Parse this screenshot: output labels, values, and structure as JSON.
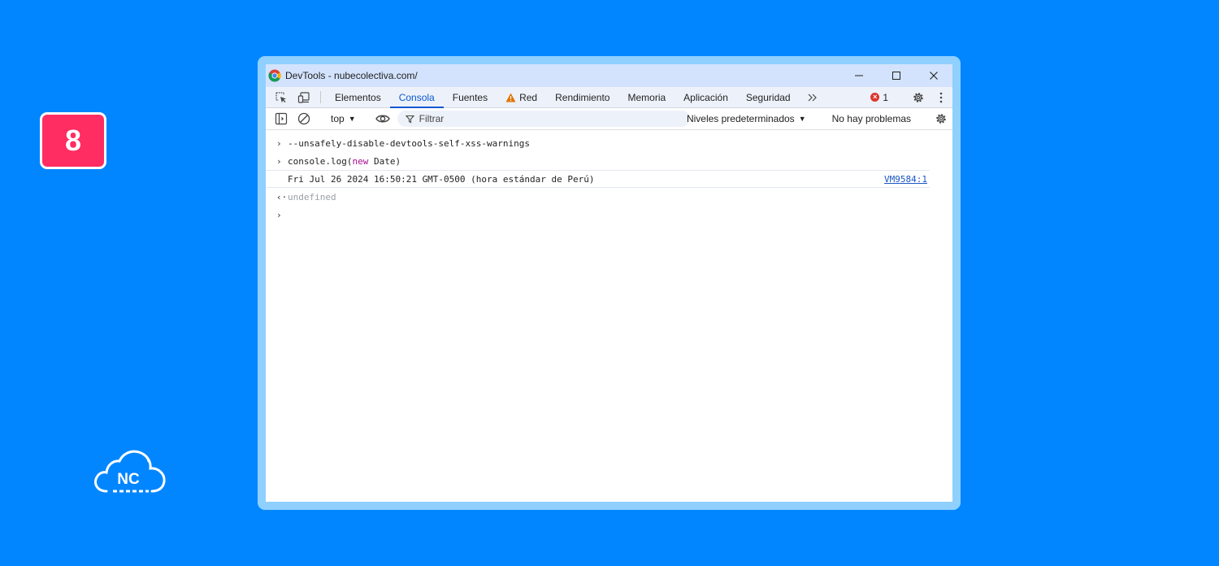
{
  "step": {
    "number": "8"
  },
  "logo": {
    "text": "NC"
  },
  "window": {
    "title": "DevTools - nubecolectiva.com/"
  },
  "tabs": [
    {
      "label": "Elementos",
      "active": false
    },
    {
      "label": "Consola",
      "active": true
    },
    {
      "label": "Fuentes",
      "active": false
    },
    {
      "label": "Red",
      "active": false,
      "warning": true
    },
    {
      "label": "Rendimiento",
      "active": false
    },
    {
      "label": "Memoria",
      "active": false
    },
    {
      "label": "Aplicación",
      "active": false
    },
    {
      "label": "Seguridad",
      "active": false
    }
  ],
  "errors": {
    "count": "1"
  },
  "toolbar": {
    "context": "top",
    "filter_placeholder": "Filtrar",
    "levels": "Niveles predeterminados",
    "issues": "No hay problemas"
  },
  "console": {
    "line1": "--unsafely-disable-devtools-self-xss-warnings",
    "line2_pre": "console.log(",
    "line2_kw": "new",
    "line2_post": " Date)",
    "output": "Fri Jul 26 2024 16:50:21 GMT-0500 (hora estándar de Perú)",
    "source": "VM9584:1",
    "result": "undefined"
  },
  "colors": {
    "background": "#0286ff",
    "badge": "#ff2d62",
    "accent": "#0b57d0",
    "error": "#dc362e",
    "warning": "#f9ab00"
  }
}
